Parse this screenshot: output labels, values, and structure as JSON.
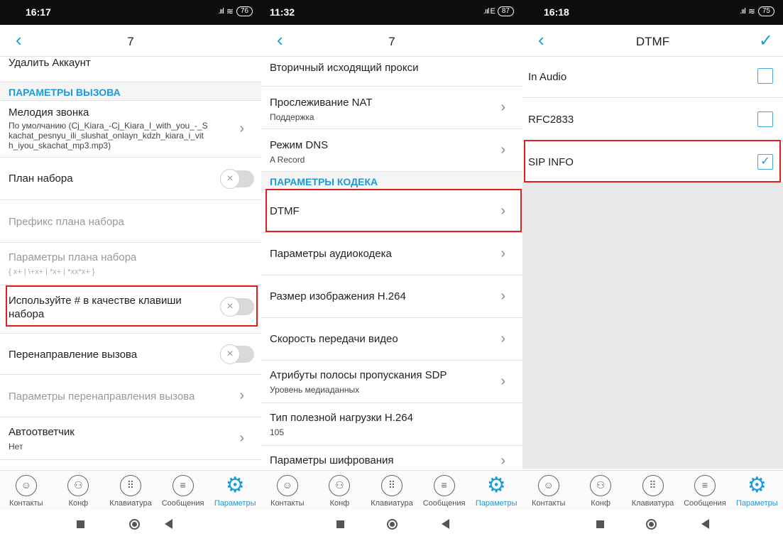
{
  "tabs": [
    {
      "label": "Контакты",
      "icon": "person-icon"
    },
    {
      "label": "Конф",
      "icon": "conference-icon"
    },
    {
      "label": "Клавиатура",
      "icon": "keypad-icon"
    },
    {
      "label": "Сообщения",
      "icon": "message-icon"
    },
    {
      "label": "Параметры",
      "icon": "gear-icon"
    }
  ],
  "accent_color": "#1a9bd7",
  "highlight_color": "#e02020",
  "panel1": {
    "status": {
      "time": "16:17",
      "battery": "76"
    },
    "title": "7",
    "rows": {
      "delete_account": "Удалить Аккаунт",
      "section_call": "ПАРАМЕТРЫ ВЫЗОВА",
      "ringtone_title": "Мелодия звонка",
      "ringtone_value": "По умолчанию (Cj_Kiara_-Cj_Kiara_I_with_you_-_S kachat_pesnyu_ili_slushat_onlayn_kdzh_kiara_i_vit h_iyou_skachat_mp3.mp3)",
      "dial_plan": "План набора",
      "dial_plan_prefix": "Префикс плана набора",
      "dial_plan_params": "Параметры плана набора",
      "dial_plan_params_value": "{ x+ | \\+x+ | *x+ | *xx*x+ }",
      "use_hash": "Используйте # в качестве клавиши набора",
      "call_forward": "Перенаправление вызова",
      "call_forward_params": "Параметры перенаправления вызова",
      "auto_answer": "Автоответчик",
      "auto_answer_value": "Нет"
    }
  },
  "panel2": {
    "status": {
      "time": "11:32",
      "battery": "87"
    },
    "title": "7",
    "rows": {
      "secondary_proxy": "Вторичный исходящий прокси",
      "nat": "Прослеживание NAT",
      "nat_value": "Поддержка",
      "dns": "Режим DNS",
      "dns_value": "A Record",
      "section_codec": "ПАРАМЕТРЫ КОДЕКА",
      "dtmf": "DTMF",
      "audio_codec": "Параметры аудиокодека",
      "h264_size": "Размер изображения H.264",
      "video_rate": "Скорость передачи видео",
      "sdp": "Атрибуты полосы пропускания SDP",
      "sdp_value": "Уровень медиаданных",
      "h264_payload": "Тип полезной нагрузки H.264",
      "h264_payload_value": "105",
      "encryption": "Параметры шифрования"
    }
  },
  "panel3": {
    "status": {
      "time": "16:18",
      "battery": "75"
    },
    "title": "DTMF",
    "options": [
      {
        "label": "In Audio",
        "checked": false
      },
      {
        "label": "RFC2833",
        "checked": false
      },
      {
        "label": "SIP INFO",
        "checked": true
      }
    ]
  }
}
